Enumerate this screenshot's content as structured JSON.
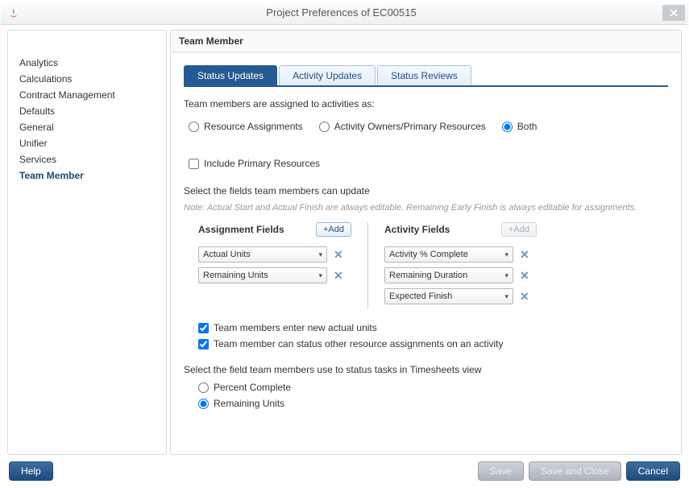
{
  "window": {
    "title": "Project Preferences of EC00515"
  },
  "sidebar": {
    "items": [
      {
        "label": "Analytics"
      },
      {
        "label": "Calculations"
      },
      {
        "label": "Contract Management"
      },
      {
        "label": "Defaults"
      },
      {
        "label": "General"
      },
      {
        "label": "Unifier"
      },
      {
        "label": "Services"
      },
      {
        "label": "Team Member"
      }
    ],
    "active_index": 7
  },
  "content": {
    "header": "Team Member",
    "tabs": [
      {
        "label": "Status Updates"
      },
      {
        "label": "Activity Updates"
      },
      {
        "label": "Status Reviews"
      }
    ],
    "active_tab": 0,
    "assign_intro": "Team members are assigned to activities as:",
    "assign_options": {
      "resource": "Resource Assignments",
      "owners": "Activity Owners/Primary Resources",
      "both": "Both",
      "include_primary": "Include Primary Resources",
      "selected": "both",
      "include_primary_checked": false
    },
    "fields_intro": "Select the fields team members can update",
    "fields_note": "Note: Actual Start and Actual Finish are always editable. Remaining Early Finish is always editable for assignments.",
    "assignment_fields": {
      "header": "Assignment Fields",
      "add_label": "+Add",
      "items": [
        "Actual Units",
        "Remaining Units"
      ]
    },
    "activity_fields": {
      "header": "Activity Fields",
      "add_label": "+Add",
      "items": [
        "Activity % Complete",
        "Remaining Duration",
        "Expected Finish"
      ]
    },
    "checks": {
      "enter_new_units": "Team members enter new actual units",
      "status_other": "Team member can status other resource assignments on an activity",
      "enter_new_units_checked": true,
      "status_other_checked": true
    },
    "timesheet": {
      "intro": "Select the field team members use to status tasks in Timesheets view",
      "percent": "Percent Complete",
      "remaining": "Remaining Units",
      "selected": "remaining"
    }
  },
  "footer": {
    "help": "Help",
    "save": "Save",
    "save_close": "Save and Close",
    "cancel": "Cancel"
  }
}
